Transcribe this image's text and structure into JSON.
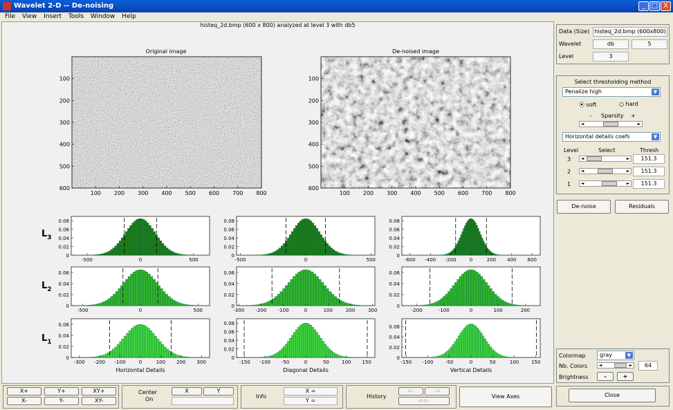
{
  "window": {
    "title": "Wavelet 2-D   --   De-noising",
    "min": "_",
    "max": "□",
    "close": "X"
  },
  "menu": [
    "File",
    "View",
    "Insert",
    "Tools",
    "Window",
    "Help"
  ],
  "caption": "histeq_2d.bmp (600 x 800) analyzed at level 3 with db5",
  "images": {
    "original_title": "Original image",
    "denoised_title": "De-noised image",
    "xticks": [
      "100",
      "200",
      "300",
      "400",
      "500",
      "600",
      "700",
      "800"
    ],
    "yticks": [
      "100",
      "200",
      "300",
      "400",
      "500",
      "600"
    ]
  },
  "level_labels": [
    "L3",
    "L2",
    "L1"
  ],
  "histograms": [
    {
      "level": "L3",
      "col": "Horizontal",
      "yticks": [
        "0",
        "0.02",
        "0.04",
        "0.06",
        "0.08"
      ],
      "xticks": [
        "-500",
        "0",
        "500"
      ],
      "ymax": 0.09,
      "xlim": [
        -650,
        650
      ],
      "sigma": 140,
      "thresh": 151.3,
      "peak": 0.085
    },
    {
      "level": "L3",
      "col": "Diagonal",
      "yticks": [
        "0",
        "0.02",
        "0.04",
        "0.06",
        "0.08"
      ],
      "xticks": [
        "-500",
        "0",
        "500"
      ],
      "ymax": 0.09,
      "xlim": [
        -530,
        530
      ],
      "sigma": 110,
      "thresh": 151.3,
      "peak": 0.085
    },
    {
      "level": "L3",
      "col": "Vertical",
      "yticks": [
        "0",
        "0.02",
        "0.04",
        "0.06",
        "0.08"
      ],
      "xticks": [
        "-600",
        "-400",
        "-200",
        "0",
        "200",
        "400",
        "600"
      ],
      "ymax": 0.09,
      "xlim": [
        -680,
        680
      ],
      "sigma": 90,
      "thresh": 151.3,
      "peak": 0.085
    },
    {
      "level": "L2",
      "col": "Horizontal",
      "yticks": [
        "0",
        "0.02",
        "0.04",
        "0.06"
      ],
      "xticks": [
        "-500",
        "0",
        "500"
      ],
      "ymax": 0.07,
      "xlim": [
        -600,
        600
      ],
      "sigma": 150,
      "thresh": 151.3,
      "peak": 0.065
    },
    {
      "level": "L2",
      "col": "Diagonal",
      "yticks": [
        "0",
        "0.02",
        "0.04",
        "0.06"
      ],
      "xticks": [
        "-300",
        "-200",
        "-100",
        "0",
        "100",
        "200",
        "300"
      ],
      "ymax": 0.07,
      "xlim": [
        -310,
        310
      ],
      "sigma": 80,
      "thresh": 151.3,
      "peak": 0.065
    },
    {
      "level": "L2",
      "col": "Vertical",
      "yticks": [
        "0",
        "0.02",
        "0.04",
        "0.06"
      ],
      "xticks": [
        "-200",
        "-100",
        "0",
        "100",
        "200"
      ],
      "ymax": 0.07,
      "xlim": [
        -255,
        255
      ],
      "sigma": 60,
      "thresh": 151.3,
      "peak": 0.065
    },
    {
      "level": "L1",
      "col": "Horizontal",
      "yticks": [
        "0",
        "0.02",
        "0.04",
        "0.06"
      ],
      "xticks": [
        "-300",
        "-200",
        "-100",
        "0",
        "100",
        "200",
        "300"
      ],
      "ymax": 0.07,
      "xlim": [
        -340,
        340
      ],
      "sigma": 80,
      "thresh": 151.3,
      "peak": 0.06
    },
    {
      "level": "L1",
      "col": "Diagonal",
      "yticks": [
        "0",
        "0.02",
        "0.04",
        "0.06",
        "0.08"
      ],
      "xticks": [
        "-150",
        "-100",
        "-50",
        "0",
        "50",
        "100",
        "150"
      ],
      "ymax": 0.09,
      "xlim": [
        -170,
        170
      ],
      "sigma": 35,
      "thresh": 151.3,
      "peak": 0.08
    },
    {
      "level": "L1",
      "col": "Vertical",
      "yticks": [
        "0",
        "0.02",
        "0.04",
        "0.06"
      ],
      "xticks": [
        "-150",
        "-100",
        "-50",
        "0",
        "50",
        "100",
        "150"
      ],
      "ymax": 0.075,
      "xlim": [
        -160,
        160
      ],
      "sigma": 30,
      "thresh": 151.3,
      "peak": 0.065
    }
  ],
  "column_titles": [
    "Horizontal Details",
    "Diagonal Details",
    "Vertical Details"
  ],
  "right": {
    "data_label": "Data  (Size)",
    "data_value": "histeq_2d.bmp  (600x800)",
    "wavelet_label": "Wavelet",
    "wavelet_family": "db",
    "wavelet_number": "5",
    "level_label": "Level",
    "level_value": "3",
    "thresh_title": "Select thresholding method",
    "method": "Penalize high",
    "soft": "soft",
    "hard": "hard",
    "sparsity": "Sparsity",
    "minus": "-",
    "plus": "+",
    "details": "Horizontal details coefs",
    "col_level": "Level",
    "col_select": "Select",
    "col_thresh": "Thresh",
    "rows": [
      {
        "level": "3",
        "thresh": "151.3"
      },
      {
        "level": "2",
        "thresh": "151.3"
      },
      {
        "level": "1",
        "thresh": "151.3"
      }
    ],
    "denoise": "De-noise",
    "residuals": "Residuals",
    "colormap_label": "Colormap",
    "colormap": "gray",
    "nbcolors_label": "Nb. Colors",
    "nbcolors": "64",
    "brightness_label": "Brightness",
    "bminus": "-",
    "bplus": "+",
    "close": "Close"
  },
  "bottom": {
    "xp": "X+",
    "yp": "Y+",
    "xyp": "XY+",
    "xm": "X-",
    "ym": "Y-",
    "xym": "XY-",
    "center1": "Center",
    "center2": "On",
    "cx": "X",
    "cy": "Y",
    "info": "Info",
    "infox": "X =",
    "infoy": "Y =",
    "history": "History",
    "hback": "<-",
    "hfwd": "->",
    "hstart": "<<-",
    "viewaxes": "View Axes"
  },
  "colors": {
    "bar_L3": "#1d7a1d",
    "bar_L2": "#2fb12f",
    "bar_L1": "#3fd23f"
  }
}
